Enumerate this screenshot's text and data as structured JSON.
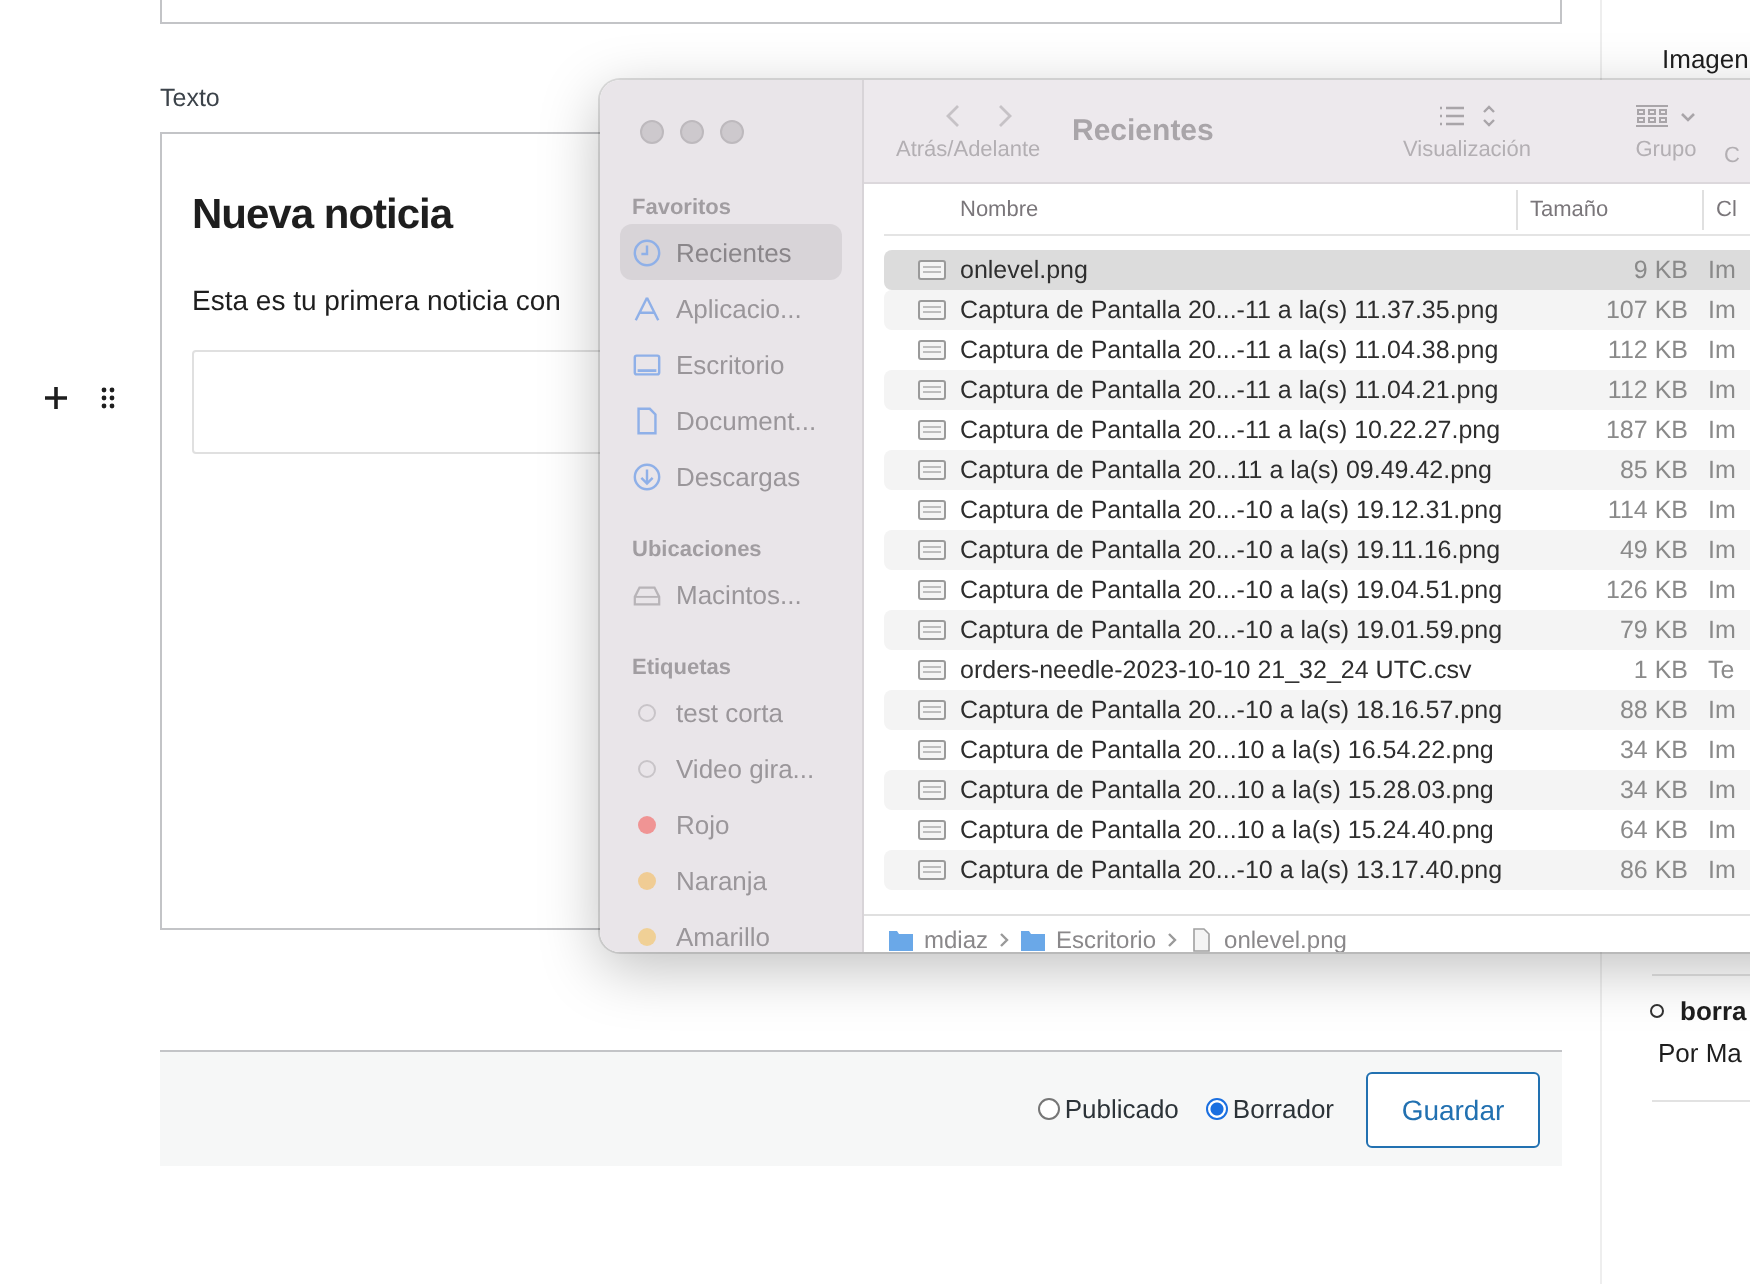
{
  "editor": {
    "label": "Texto",
    "heading": "Nueva noticia",
    "paragraph": "Esta es tu primera noticia con"
  },
  "footer": {
    "options": [
      {
        "label": "Publicado",
        "selected": false
      },
      {
        "label": "Borrador",
        "selected": true
      }
    ],
    "save_button": "Guardar"
  },
  "side_panel": {
    "heading": "Imagen",
    "list_item": "borra",
    "byline": "Por Ma"
  },
  "finder": {
    "toolbar": {
      "nav_label": "Atrás/Adelante",
      "title": "Recientes",
      "view_label": "Visualización",
      "group_label": "Grupo",
      "cut_label": "C"
    },
    "sidebar": [
      {
        "heading": "Favoritos",
        "kind": "places",
        "items": [
          {
            "label": "Recientes",
            "selected": true
          },
          {
            "label": "Aplicacio...",
            "selected": false
          },
          {
            "label": "Escritorio",
            "selected": false
          },
          {
            "label": "Document...",
            "selected": false
          },
          {
            "label": "Descargas",
            "selected": false
          }
        ]
      },
      {
        "heading": "Ubicaciones",
        "kind": "locations",
        "items": [
          {
            "label": "Macintos...",
            "selected": false
          }
        ]
      },
      {
        "heading": "Etiquetas",
        "kind": "tags",
        "items": [
          {
            "label": "test corta",
            "selected": false
          },
          {
            "label": "Video gira...",
            "selected": false
          },
          {
            "label": "Rojo",
            "selected": false,
            "color": "#f09494"
          },
          {
            "label": "Naranja",
            "selected": false,
            "color": "#f0cc94"
          },
          {
            "label": "Amarillo",
            "selected": false,
            "color": "#f0d096"
          }
        ]
      }
    ],
    "columns": [
      "Nombre",
      "Tamaño",
      "Cl"
    ],
    "rows": [
      {
        "name": "onlevel.png",
        "size": "9 KB",
        "column_3": "Im",
        "selected": true
      },
      {
        "name": "Captura de Pantalla 20...-11 a la(s) 11.37.35.png",
        "size": "107 KB",
        "column_3": "Im",
        "selected": false
      },
      {
        "name": "Captura de Pantalla 20...-11 a la(s) 11.04.38.png",
        "size": "112 KB",
        "column_3": "Im",
        "selected": false
      },
      {
        "name": "Captura de Pantalla 20...-11 a la(s) 11.04.21.png",
        "size": "112 KB",
        "column_3": "Im",
        "selected": false
      },
      {
        "name": "Captura de Pantalla 20...-11 a la(s) 10.22.27.png",
        "size": "187 KB",
        "column_3": "Im",
        "selected": false
      },
      {
        "name": "Captura de Pantalla 20...11 a la(s) 09.49.42.png",
        "size": "85 KB",
        "column_3": "Im",
        "selected": false
      },
      {
        "name": "Captura de Pantalla 20...-10 a la(s) 19.12.31.png",
        "size": "114 KB",
        "column_3": "Im",
        "selected": false
      },
      {
        "name": "Captura de Pantalla 20...-10 a la(s) 19.11.16.png",
        "size": "49 KB",
        "column_3": "Im",
        "selected": false
      },
      {
        "name": "Captura de Pantalla 20...-10 a la(s) 19.04.51.png",
        "size": "126 KB",
        "column_3": "Im",
        "selected": false
      },
      {
        "name": "Captura de Pantalla 20...-10 a la(s) 19.01.59.png",
        "size": "79 KB",
        "column_3": "Im",
        "selected": false
      },
      {
        "name": "orders-needle-2023-10-10 21_32_24 UTC.csv",
        "size": "1 KB",
        "column_3": "Te",
        "selected": false
      },
      {
        "name": "Captura de Pantalla 20...-10 a la(s) 18.16.57.png",
        "size": "88 KB",
        "column_3": "Im",
        "selected": false
      },
      {
        "name": "Captura de Pantalla 20...10 a la(s) 16.54.22.png",
        "size": "34 KB",
        "column_3": "Im",
        "selected": false
      },
      {
        "name": "Captura de Pantalla 20...10 a la(s) 15.28.03.png",
        "size": "34 KB",
        "column_3": "Im",
        "selected": false
      },
      {
        "name": "Captura de Pantalla 20...10 a la(s) 15.24.40.png",
        "size": "64 KB",
        "column_3": "Im",
        "selected": false
      },
      {
        "name": "Captura de Pantalla 20...-10 a la(s) 13.17.40.png",
        "size": "86 KB",
        "column_3": "Im",
        "selected": false
      }
    ],
    "path": [
      "mdiaz",
      "Escritorio",
      "onlevel.png"
    ]
  }
}
